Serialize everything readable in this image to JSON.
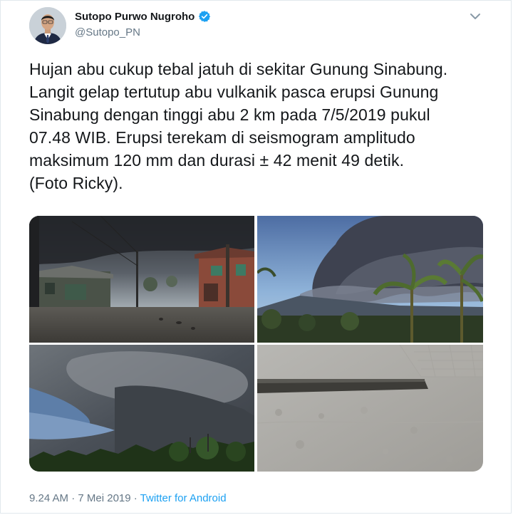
{
  "user": {
    "name": "Sutopo Purwo Nugroho",
    "handle": "@Sutopo_PN",
    "verified": true
  },
  "tweet": {
    "lines": [
      "Hujan abu cukup tebal jatuh di sekitar Gunung Sinabung.",
      "Langit gelap tertutup abu vulkanik pasca erupsi Gunung",
      "Sinabung dengan tinggi abu 2 km pada 7/5/2019 pukul",
      "07.48 WIB. Erupsi terekam di seismogram amplitudo",
      "maksimum 120 mm dan durasi ± 42 menit 49 detik.",
      "(Foto Ricky)."
    ]
  },
  "media": {
    "count": 4,
    "photos": [
      "ash-covered-street-photo",
      "eruption-plume-photo",
      "dark-sky-clouds-photo",
      "ash-covered-ground-photo"
    ]
  },
  "meta": {
    "time": "9.24 AM",
    "separator": " · ",
    "date": "7 Mei 2019",
    "separator2": " · ",
    "source": "Twitter for Android"
  },
  "colors": {
    "accent": "#1da1f2",
    "text": "#14171a",
    "secondary": "#657786"
  },
  "icons": {
    "verified": "verified-badge-icon",
    "caret": "chevron-down-icon"
  }
}
